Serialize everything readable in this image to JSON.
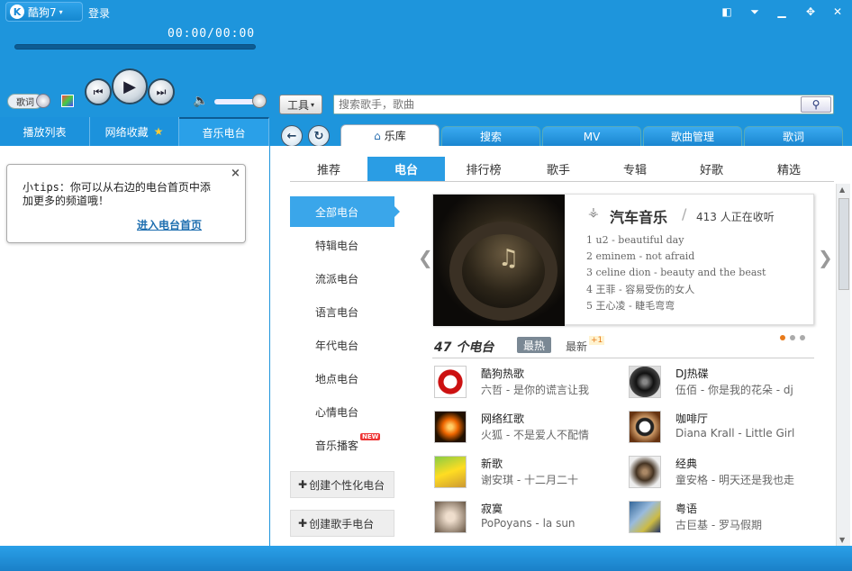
{
  "app": {
    "title": "酷狗7",
    "login": "登录",
    "time": "00:00/00:00"
  },
  "player": {
    "lyric_toggle": "歌词"
  },
  "left_tabs": [
    {
      "label": "播放列表"
    },
    {
      "label": "网络收藏"
    },
    {
      "label": "音乐电台"
    }
  ],
  "tips": {
    "text": "小tips：你可以从右边的电台首页中添加更多的频道哦！",
    "link": "进入电台首页",
    "close": "×"
  },
  "toolbar": {
    "tools": "工具",
    "search_placeholder": "搜索歌手，歌曲"
  },
  "main_tabs": [
    {
      "label": "乐库"
    },
    {
      "label": "搜索"
    },
    {
      "label": "MV"
    },
    {
      "label": "歌曲管理"
    },
    {
      "label": "歌词"
    }
  ],
  "sub_tabs": [
    {
      "label": "推荐"
    },
    {
      "label": "电台"
    },
    {
      "label": "排行榜"
    },
    {
      "label": "歌手"
    },
    {
      "label": "专辑"
    },
    {
      "label": "好歌"
    },
    {
      "label": "精选"
    }
  ],
  "side_menu": [
    {
      "label": "全部电台"
    },
    {
      "label": "特辑电台"
    },
    {
      "label": "流派电台"
    },
    {
      "label": "语言电台"
    },
    {
      "label": "年代电台"
    },
    {
      "label": "地点电台"
    },
    {
      "label": "心情电台"
    },
    {
      "label": "音乐播客",
      "badge": "NEW"
    }
  ],
  "create_buttons": [
    {
      "label": "创建个性化电台"
    },
    {
      "label": "创建歌手电台"
    }
  ],
  "featured": {
    "title": "汽车音乐",
    "listeners": "413 人正在收听",
    "songs": [
      "1  u2 - beautiful day",
      "2  eminem - not afraid",
      "3  celine dion - beauty and the beast",
      "4  王菲  - 容易受伤的女人",
      "5  王心凌  - 睫毛弯弯"
    ]
  },
  "stations_header": {
    "count": "47 个电台",
    "hot": "最热",
    "latest": "最新",
    "plus": "+1"
  },
  "stations": [
    {
      "name": "酷狗热歌",
      "song": "六哲 - 是你的谎言让我"
    },
    {
      "name": "DJ热碟",
      "song": "伍佰 - 你是我的花朵 - dj"
    },
    {
      "name": "网络红歌",
      "song": "火狐 - 不是爱人不配情"
    },
    {
      "name": "咖啡厅",
      "song": "Diana Krall - Little Girl"
    },
    {
      "name": "新歌",
      "song": "谢安琪 - 十二月二十"
    },
    {
      "name": "经典",
      "song": "童安格 - 明天还是我也走"
    },
    {
      "name": "寂寞",
      "song": "PoPoyans - la sun"
    },
    {
      "name": "粤语",
      "song": "古巨基 - 罗马假期"
    }
  ]
}
